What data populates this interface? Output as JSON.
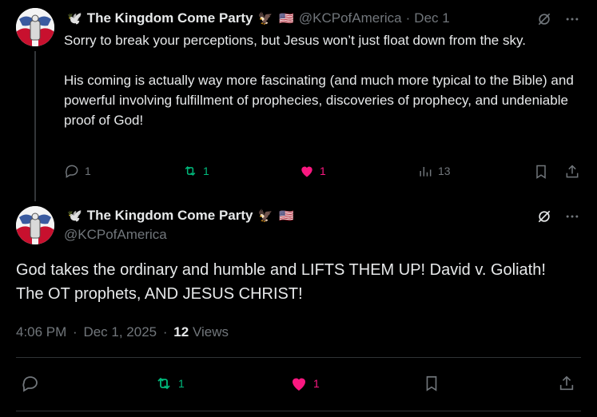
{
  "tweet1": {
    "name": "The Kingdom Come Party",
    "dove_emoji": "🕊️",
    "eagle_emoji": "🦅",
    "flag_emoji": "🇺🇸",
    "handle": "@KCPofAmerica",
    "sep": "·",
    "date": "Dec 1",
    "text_p1": "Sorry to break your perceptions, but Jesus won’t just float down from the sky.",
    "text_p2": "His coming is actually way more fascinating (and much more typical to the Bible) and powerful involving fulfillment of prophecies, discoveries of prophecy, and undeniable proof of God!",
    "replies": "1",
    "retweets": "1",
    "likes": "1",
    "views": "13"
  },
  "tweet2": {
    "name": "The Kingdom Come Party",
    "dove_emoji": "🕊️",
    "eagle_emoji": "🦅",
    "flag_emoji": "🇺🇸",
    "handle": "@KCPofAmerica",
    "text": "God takes the ordinary and humble and LIFTS THEM UP! David v. Goliath! The OT prophets, AND JESUS CHRIST!",
    "time": "4:06 PM",
    "sep1": "·",
    "date": "Dec 1, 2025",
    "sep2": "·",
    "views_count": "12",
    "views_label": "Views",
    "retweets": "1",
    "likes": "1"
  },
  "colors": {
    "background": "#000000",
    "text": "#e7e9ea",
    "muted": "#71767b",
    "retweet": "#00ba7c",
    "like": "#f91880"
  }
}
